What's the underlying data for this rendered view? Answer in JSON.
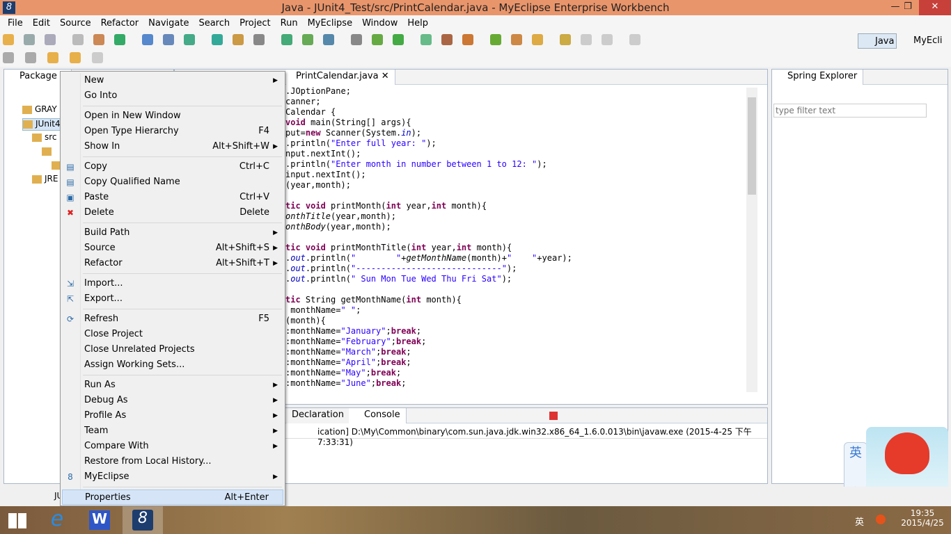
{
  "window": {
    "title": "Java - JUnit4_Test/src/PrintCalendar.java - MyEclipse Enterprise Workbench",
    "minimize": "—",
    "restore": "❐",
    "close": "✕"
  },
  "menubar": [
    "File",
    "Edit",
    "Source",
    "Refactor",
    "Navigate",
    "Search",
    "Project",
    "Run",
    "MyEclipse",
    "Window",
    "Help"
  ],
  "perspectives": {
    "java": "Java",
    "myeclipse": "MyEcli"
  },
  "package_explorer": {
    "title": "Package E",
    "tree": [
      "GRAY",
      "JUnit4",
      "src",
      "",
      "",
      "JRE"
    ]
  },
  "editor": {
    "tab": "PrintCalendar.java",
    "lines": [
      ".JOptionPane;",
      "canner;",
      "Calendar {",
      "void main(String[] args){",
      "put=new Scanner(System.in);",
      ".println(\"Enter full year: \");",
      "nput.nextInt();",
      ".println(\"Enter month in number between 1 to 12: \");",
      "input.nextInt();",
      "(year,month);",
      "",
      "tic void printMonth(int year,int month){",
      "onthTitle(year,month);",
      "onthBody(year,month);",
      "",
      "tic void printMonthTitle(int year,int month){",
      ".out.println(\"        \"+getMonthName(month)+\"    \"+year);",
      ".out.println(\"-----------------------------\");",
      ".out.println(\" Sun Mon Tue Wed Thu Fri Sat\");",
      "",
      "tic String getMonthName(int month){",
      " monthName=\" \";",
      "(month){",
      ":monthName=\"January\";break;",
      ":monthName=\"February\";break;",
      ":monthName=\"March\";break;",
      ":monthName=\"April\";break;",
      ":monthName=\"May\";break;",
      ":monthName=\"June\";break;"
    ]
  },
  "bottom": {
    "tabs": [
      "Declaration",
      "Console"
    ],
    "console_header": "ication] D:\\My\\Common\\binary\\com.sun.java.jdk.win32.x86_64_1.6.0.013\\bin\\javaw.exe (2015-4-25 下午7:33:31)"
  },
  "spring_explorer": {
    "title": "Spring Explorer",
    "filter_placeholder": "type filter text"
  },
  "status": {
    "text": "JU"
  },
  "context_menu": [
    {
      "label": "New",
      "arrow": true
    },
    {
      "label": "Go Into"
    },
    {
      "sep": true
    },
    {
      "label": "Open in New Window"
    },
    {
      "label": "Open Type Hierarchy",
      "shortcut": "F4"
    },
    {
      "label": "Show In",
      "shortcut": "Alt+Shift+W",
      "arrow": true
    },
    {
      "sep": true
    },
    {
      "label": "Copy",
      "shortcut": "Ctrl+C",
      "icon": "copy-icon"
    },
    {
      "label": "Copy Qualified Name",
      "icon": "copy-qualified-icon"
    },
    {
      "label": "Paste",
      "shortcut": "Ctrl+V",
      "icon": "paste-icon"
    },
    {
      "label": "Delete",
      "shortcut": "Delete",
      "icon": "delete-icon"
    },
    {
      "sep": true
    },
    {
      "label": "Build Path",
      "arrow": true
    },
    {
      "label": "Source",
      "shortcut": "Alt+Shift+S",
      "arrow": true
    },
    {
      "label": "Refactor",
      "shortcut": "Alt+Shift+T",
      "arrow": true
    },
    {
      "sep": true
    },
    {
      "label": "Import...",
      "icon": "import-icon"
    },
    {
      "label": "Export...",
      "icon": "export-icon"
    },
    {
      "sep": true
    },
    {
      "label": "Refresh",
      "shortcut": "F5",
      "icon": "refresh-icon"
    },
    {
      "label": "Close Project"
    },
    {
      "label": "Close Unrelated Projects"
    },
    {
      "label": "Assign Working Sets..."
    },
    {
      "sep": true
    },
    {
      "label": "Run As",
      "arrow": true
    },
    {
      "label": "Debug As",
      "arrow": true
    },
    {
      "label": "Profile As",
      "arrow": true
    },
    {
      "label": "Team",
      "arrow": true
    },
    {
      "label": "Compare With",
      "arrow": true
    },
    {
      "label": "Restore from Local History..."
    },
    {
      "label": "MyEclipse",
      "arrow": true,
      "icon": "myeclipse-icon"
    },
    {
      "sep": true
    },
    {
      "label": "Properties",
      "shortcut": "Alt+Enter",
      "highlighted": true
    }
  ],
  "ime": {
    "lang": "英"
  },
  "tray": {
    "lang": "英",
    "time": "19:35",
    "date": "2015/4/25"
  },
  "colors": {
    "titlebar": "#e9956b",
    "keyword": "#7f0055",
    "string": "#2a00ff",
    "selection": "#d5e5f7"
  }
}
